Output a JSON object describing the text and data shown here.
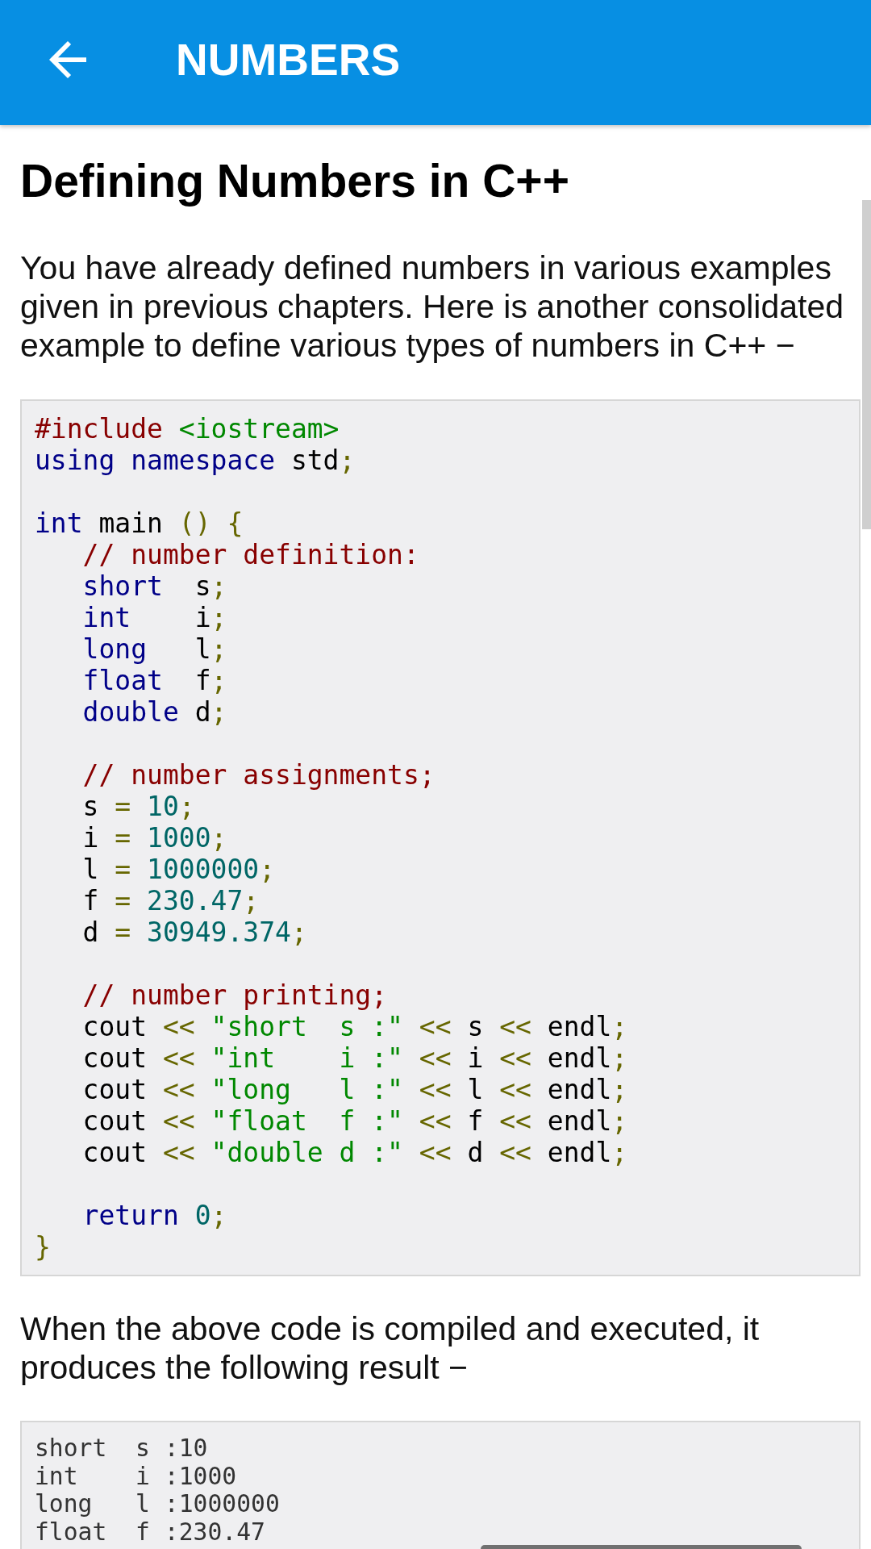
{
  "app_bar": {
    "title": "NUMBERS"
  },
  "article": {
    "heading": "Defining Numbers in C++",
    "intro": "You have already defined numbers in various examples given in previous chapters. Here is another consolidated example to define various types of numbers in C++ −",
    "code": {
      "blocks": [
        [
          {
            "tokens": [
              {
                "kind": "com",
                "text": "#include "
              },
              {
                "kind": "str",
                "text": "<iostream>"
              }
            ]
          },
          {
            "tokens": [
              {
                "kind": "kwd",
                "text": "using namespace"
              },
              {
                "kind": "pln",
                "text": " std"
              },
              {
                "kind": "pun",
                "text": ";"
              }
            ]
          }
        ],
        [
          {
            "tokens": [
              {
                "kind": "kwd",
                "text": "int"
              },
              {
                "kind": "pln",
                "text": " main "
              },
              {
                "kind": "pun",
                "text": "() {"
              }
            ]
          },
          {
            "tokens": [
              {
                "kind": "com",
                "text": "   // number definition:"
              }
            ]
          },
          {
            "tokens": [
              {
                "kind": "kwd",
                "text": "   short"
              },
              {
                "kind": "pln",
                "text": "  s"
              },
              {
                "kind": "pun",
                "text": ";"
              }
            ]
          },
          {
            "tokens": [
              {
                "kind": "kwd",
                "text": "   int"
              },
              {
                "kind": "pln",
                "text": "    i"
              },
              {
                "kind": "pun",
                "text": ";"
              }
            ]
          },
          {
            "tokens": [
              {
                "kind": "kwd",
                "text": "   long"
              },
              {
                "kind": "pln",
                "text": "   l"
              },
              {
                "kind": "pun",
                "text": ";"
              }
            ]
          },
          {
            "tokens": [
              {
                "kind": "kwd",
                "text": "   float"
              },
              {
                "kind": "pln",
                "text": "  f"
              },
              {
                "kind": "pun",
                "text": ";"
              }
            ]
          },
          {
            "tokens": [
              {
                "kind": "kwd",
                "text": "   double"
              },
              {
                "kind": "pln",
                "text": " d"
              },
              {
                "kind": "pun",
                "text": ";"
              }
            ]
          }
        ],
        [
          {
            "tokens": [
              {
                "kind": "com",
                "text": "   // number assignments;"
              }
            ]
          },
          {
            "tokens": [
              {
                "kind": "pln",
                "text": "   s "
              },
              {
                "kind": "pun",
                "text": "= "
              },
              {
                "kind": "lit",
                "text": "10"
              },
              {
                "kind": "pun",
                "text": ";"
              }
            ]
          },
          {
            "tokens": [
              {
                "kind": "pln",
                "text": "   i "
              },
              {
                "kind": "pun",
                "text": "= "
              },
              {
                "kind": "lit",
                "text": "1000"
              },
              {
                "kind": "pun",
                "text": ";"
              }
            ]
          },
          {
            "tokens": [
              {
                "kind": "pln",
                "text": "   l "
              },
              {
                "kind": "pun",
                "text": "= "
              },
              {
                "kind": "lit",
                "text": "1000000"
              },
              {
                "kind": "pun",
                "text": ";"
              }
            ]
          },
          {
            "tokens": [
              {
                "kind": "pln",
                "text": "   f "
              },
              {
                "kind": "pun",
                "text": "= "
              },
              {
                "kind": "lit",
                "text": "230.47"
              },
              {
                "kind": "pun",
                "text": ";"
              }
            ]
          },
          {
            "tokens": [
              {
                "kind": "pln",
                "text": "   d "
              },
              {
                "kind": "pun",
                "text": "= "
              },
              {
                "kind": "lit",
                "text": "30949.374"
              },
              {
                "kind": "pun",
                "text": ";"
              }
            ]
          }
        ],
        [
          {
            "tokens": [
              {
                "kind": "com",
                "text": "   // number printing;"
              }
            ]
          },
          {
            "tokens": [
              {
                "kind": "pln",
                "text": "   cout "
              },
              {
                "kind": "pun",
                "text": "<< "
              },
              {
                "kind": "str",
                "text": "\"short  s :\""
              },
              {
                "kind": "pun",
                "text": " << "
              },
              {
                "kind": "pln",
                "text": "s "
              },
              {
                "kind": "pun",
                "text": "<< "
              },
              {
                "kind": "pln",
                "text": "endl"
              },
              {
                "kind": "pun",
                "text": ";"
              }
            ]
          },
          {
            "tokens": [
              {
                "kind": "pln",
                "text": "   cout "
              },
              {
                "kind": "pun",
                "text": "<< "
              },
              {
                "kind": "str",
                "text": "\"int    i :\""
              },
              {
                "kind": "pun",
                "text": " << "
              },
              {
                "kind": "pln",
                "text": "i "
              },
              {
                "kind": "pun",
                "text": "<< "
              },
              {
                "kind": "pln",
                "text": "endl"
              },
              {
                "kind": "pun",
                "text": ";"
              }
            ]
          },
          {
            "tokens": [
              {
                "kind": "pln",
                "text": "   cout "
              },
              {
                "kind": "pun",
                "text": "<< "
              },
              {
                "kind": "str",
                "text": "\"long   l :\""
              },
              {
                "kind": "pun",
                "text": " << "
              },
              {
                "kind": "pln",
                "text": "l "
              },
              {
                "kind": "pun",
                "text": "<< "
              },
              {
                "kind": "pln",
                "text": "endl"
              },
              {
                "kind": "pun",
                "text": ";"
              }
            ]
          },
          {
            "tokens": [
              {
                "kind": "pln",
                "text": "   cout "
              },
              {
                "kind": "pun",
                "text": "<< "
              },
              {
                "kind": "str",
                "text": "\"float  f :\""
              },
              {
                "kind": "pun",
                "text": " << "
              },
              {
                "kind": "pln",
                "text": "f "
              },
              {
                "kind": "pun",
                "text": "<< "
              },
              {
                "kind": "pln",
                "text": "endl"
              },
              {
                "kind": "pun",
                "text": ";"
              }
            ]
          },
          {
            "tokens": [
              {
                "kind": "pln",
                "text": "   cout "
              },
              {
                "kind": "pun",
                "text": "<< "
              },
              {
                "kind": "str",
                "text": "\"double d :\""
              },
              {
                "kind": "pun",
                "text": " << "
              },
              {
                "kind": "pln",
                "text": "d "
              },
              {
                "kind": "pun",
                "text": "<< "
              },
              {
                "kind": "pln",
                "text": "endl"
              },
              {
                "kind": "pun",
                "text": ";"
              }
            ]
          }
        ],
        [
          {
            "tokens": [
              {
                "kind": "kwd",
                "text": "   return"
              },
              {
                "kind": "lit",
                "text": " 0"
              },
              {
                "kind": "pun",
                "text": ";"
              }
            ]
          },
          {
            "tokens": [
              {
                "kind": "pun",
                "text": "}"
              }
            ]
          }
        ]
      ]
    },
    "result_text": "When the above code is compiled and executed, it produces the following result −",
    "output": {
      "lines": [
        "short  s :10",
        "int    i :1000",
        "long   l :1000000",
        "float  f :230.47"
      ]
    }
  }
}
